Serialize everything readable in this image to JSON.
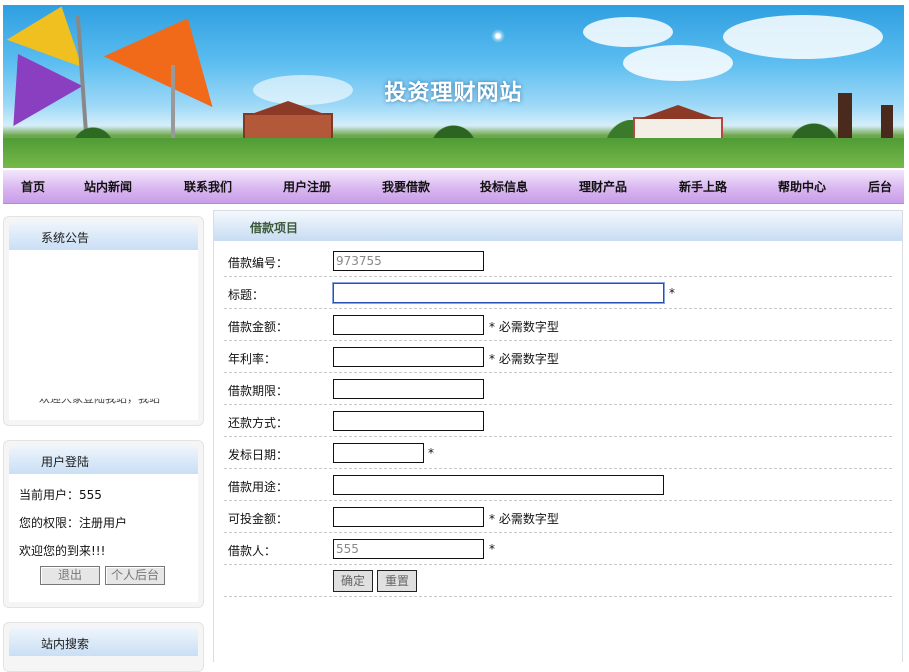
{
  "banner": {
    "title": "投资理财网站"
  },
  "nav": [
    "首页",
    "站内新闻",
    "联系我们",
    "用户注册",
    "我要借款",
    "投标信息",
    "理财产品",
    "新手上路",
    "帮助中心",
    "后台"
  ],
  "sidebar": {
    "notice": {
      "title": "系统公告",
      "scroll_text": "欢迎大家登陆我站，我站"
    },
    "login": {
      "title": "用户登陆",
      "current_user": "当前用户：555",
      "role": "您的权限：注册用户",
      "welcome": "欢迎您的到来!!!",
      "logout": "退出",
      "personal": "个人后台"
    },
    "search": {
      "title": "站内搜索"
    }
  },
  "form": {
    "title": "借款项目",
    "fields": [
      {
        "label": "借款编号：",
        "value": "973755",
        "hint": ""
      },
      {
        "label": "标题：",
        "value": "",
        "hint": "*"
      },
      {
        "label": "借款金额：",
        "value": "",
        "hint": "* 必需数字型"
      },
      {
        "label": "年利率：",
        "value": "",
        "hint": "* 必需数字型"
      },
      {
        "label": "借款期限：",
        "value": "",
        "hint": ""
      },
      {
        "label": "还款方式：",
        "value": "",
        "hint": ""
      },
      {
        "label": "发标日期：",
        "value": "",
        "hint": "*"
      },
      {
        "label": "借款用途：",
        "value": "",
        "hint": ""
      },
      {
        "label": "可投金额：",
        "value": "",
        "hint": "* 必需数字型"
      },
      {
        "label": "借款人：",
        "value": "555",
        "hint": "*"
      }
    ],
    "submit": "确定",
    "reset": "重置"
  }
}
